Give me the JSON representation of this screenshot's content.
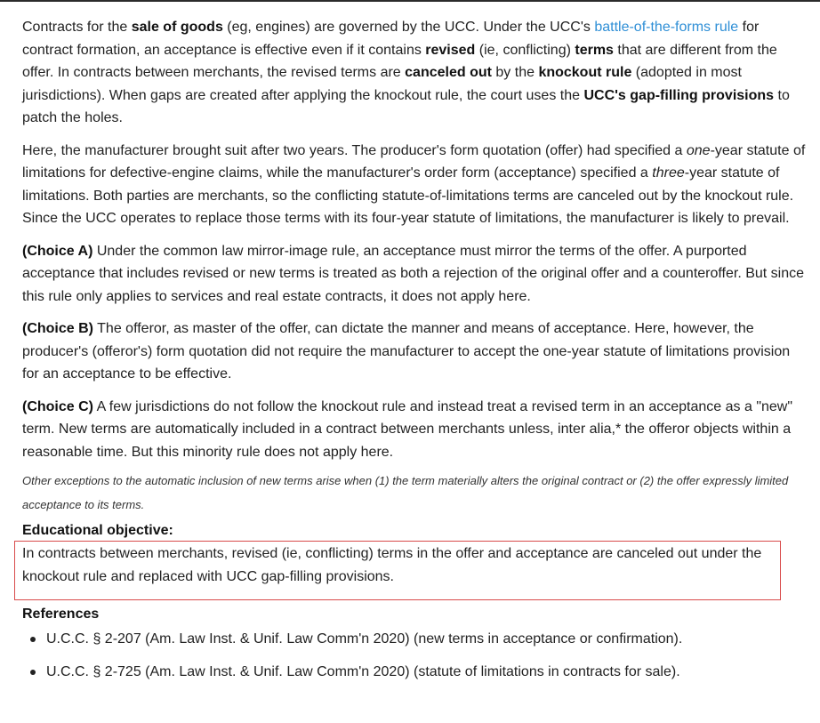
{
  "explanation": {
    "p1": {
      "t1": "Contracts for the ",
      "b1": "sale of goods",
      "t2": " (eg, engines) are governed by the UCC.  Under the UCC's ",
      "link": "battle-of-the-forms rule",
      "t3": " for contract formation, an acceptance is effective even if it contains ",
      "b2": "revised",
      "t4": " (ie, conflicting) ",
      "b3": "terms",
      "t5": " that are different from the offer.  In contracts between merchants, the revised terms are ",
      "b4": "canceled out",
      "t6": " by the ",
      "b5": "knockout rule",
      "t7": " (adopted in most jurisdictions).  When gaps are created after applying the knockout rule, the court uses the ",
      "b6": "UCC's gap-filling provisions",
      "t8": " to patch the holes."
    },
    "p2": {
      "t1": "Here, the manufacturer brought suit after two years.  The producer's form quotation (offer) had specified a ",
      "i1": "one",
      "t2": "-year statute of limitations for defective-engine claims, while the manufacturer's order form (acceptance) specified a ",
      "i2": "three",
      "t3": "-year statute of limitations.  Both parties are merchants, so the conflicting statute-of-limitations terms are canceled out by the knockout rule.  Since the UCC operates to replace those terms with its four-year statute of limitations, the manufacturer is likely to prevail."
    },
    "choice_a": {
      "label": "(Choice A)",
      "text": "  Under the common law mirror-image rule, an acceptance must mirror the terms of the offer.  A purported acceptance that includes revised or new terms is treated as both a rejection of the original offer and a counteroffer.  But since this rule only applies to services and real estate contracts, it does not apply here."
    },
    "choice_b": {
      "label": "(Choice B)",
      "text": "  The offeror, as master of the offer, can dictate the manner and means of acceptance.  Here, however, the producer's (offeror's) form quotation did not require the manufacturer to accept the one-year statute of limitations provision for an acceptance to be effective."
    },
    "choice_c": {
      "label": "(Choice C)",
      "text": "  A few jurisdictions do not follow the knockout rule and instead treat a revised term in an acceptance as a \"new\" term.  New terms are automatically included in a contract between merchants unless, inter alia,* the offeror objects within a reasonable time.  But this minority rule does not apply here."
    },
    "footnote": "Other exceptions to the automatic inclusion of new terms arise when (1) the term materially alters the original contract or (2) the offer expressly limited acceptance to its terms."
  },
  "educational_objective": {
    "heading": "Educational objective:",
    "text": "In contracts between merchants, revised (ie, conflicting) terms in the offer and acceptance are canceled out under the knockout rule and replaced with UCC gap-filling provisions."
  },
  "references": {
    "heading": "References",
    "items": [
      "U.C.C. § 2-207 (Am. Law Inst. & Unif. Law Comm'n 2020) (new terms in acceptance or confirmation).",
      "U.C.C. § 2-725 (Am. Law Inst. & Unif. Law Comm'n 2020) (statute of limitations in contracts for sale)."
    ]
  },
  "colors": {
    "link": "#2f8fd6",
    "objective_border": "#d94a4a",
    "text": "#222222"
  }
}
